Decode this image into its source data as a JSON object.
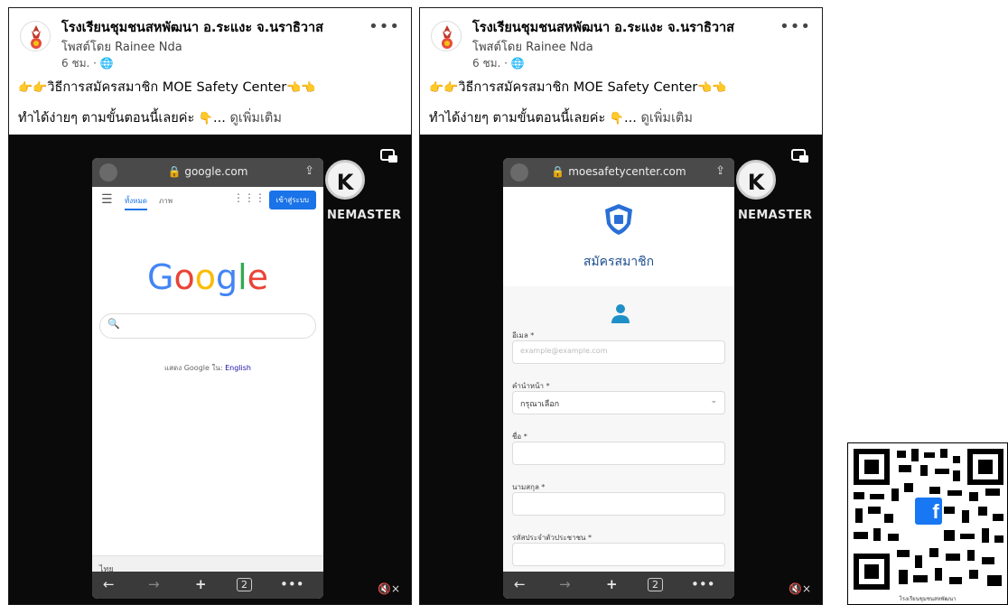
{
  "posts": [
    {
      "page_name": "โรงเรียนชุมชนสหพัฒนา อ.ระแงะ จ.นราธิวาส",
      "posted_by": "โพสต์โดย Rainee Nda",
      "time": "6 ชม. · ",
      "more_icon": "•••",
      "title_prefix": "👉👉",
      "title": "วิธีการสมัครสมาชิก MOE Safety Center",
      "title_suffix": "👈👈",
      "body": "ทำได้ง่ายๆ ตามขั้นตอนนี้เลยค่ะ ",
      "body_emoji": "👇",
      "body_ellipsis": "... ",
      "see_more": "ดูเพิ่มเติม",
      "video": {
        "url": "google.com",
        "kinemaster": "NEMASTER",
        "km_logo": "K",
        "mute": "🔇×",
        "google": {
          "tab_all": "ทั้งหมด",
          "tab_images": "ภาพ",
          "signin": "เข้าสู่ระบบ",
          "logo_letters": [
            "G",
            "o",
            "o",
            "g",
            "l",
            "e"
          ],
          "logo_colors": [
            "#4285F4",
            "#EA4335",
            "#FBBC05",
            "#4285F4",
            "#34A853",
            "#EA4335"
          ],
          "lang_prefix": "แสดง Google ใน:  ",
          "lang_link": "English",
          "thai_label": "ไทย"
        }
      }
    },
    {
      "page_name": "โรงเรียนชุมชนสหพัฒนา อ.ระแงะ จ.นราธิวาส",
      "posted_by": "โพสต์โดย Rainee Nda",
      "time": "6 ชม. · ",
      "more_icon": "•••",
      "title_prefix": "👉👉",
      "title": "วิธีการสมัครสมาชิก MOE Safety Center",
      "title_suffix": "👈👈",
      "body": "ทำได้ง่ายๆ ตามขั้นตอนนี้เลยค่ะ ",
      "body_emoji": "👇",
      "body_ellipsis": "... ",
      "see_more": "ดูเพิ่มเติม",
      "video": {
        "url": "moesafetycenter.com",
        "kinemaster": "NEMASTER",
        "km_logo": "K",
        "mute": "🔇×",
        "form": {
          "title": "สมัครสมาชิก",
          "email_label": "อีเมล *",
          "email_placeholder": "example@example.com",
          "prefix_label": "คำนำหน้า *",
          "prefix_value": "กรุณาเลือก",
          "name_label": "ชื่อ *",
          "surname_label": "นามสกุล *",
          "id_label": "รหัสประจำตัวประชาชน *"
        }
      }
    }
  ],
  "qr": {
    "center_icon": "f",
    "caption": "โรงเรียนชุมชนสหพัฒนา"
  },
  "colors": {
    "facebook_blue": "#1877F2",
    "moe_blue": "#1e4f8f",
    "google_blue": "#1a73e8"
  }
}
